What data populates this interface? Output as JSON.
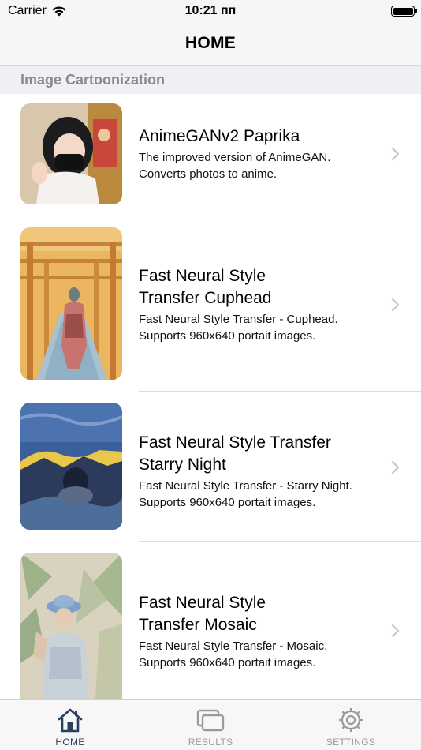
{
  "status_bar": {
    "carrier": "Carrier",
    "time": "10:21 пп"
  },
  "nav": {
    "title": "HOME"
  },
  "section": {
    "title": "Image Cartoonization"
  },
  "items": [
    {
      "title_lines": [
        "AnimeGANv2 Paprika"
      ],
      "description_lines": [
        "The improved version of AnimeGAN.",
        "Converts photos to anime."
      ]
    },
    {
      "title_lines": [
        "Fast Neural Style",
        "Transfer Cuphead"
      ],
      "description_lines": [
        "Fast Neural Style Transfer - Cuphead.",
        "Supports 960x640 portait images."
      ]
    },
    {
      "title_lines": [
        "Fast Neural Style Transfer",
        "Starry Night"
      ],
      "description_lines": [
        "Fast Neural Style Transfer - Starry Night.",
        "Supports 960x640 portait images."
      ]
    },
    {
      "title_lines": [
        "Fast Neural Style",
        "Transfer Mosaic"
      ],
      "description_lines": [
        "Fast Neural Style Transfer - Mosaic.",
        "Supports 960x640 portait images."
      ]
    }
  ],
  "tabs": [
    {
      "label": "HOME",
      "icon": "home-icon",
      "active": true
    },
    {
      "label": "RESULTS",
      "icon": "results-icon",
      "active": false
    },
    {
      "label": "SETTINGS",
      "icon": "settings-icon",
      "active": false
    }
  ],
  "colors": {
    "tab_active": "#2a3f5a",
    "tab_inactive": "#9a9a9a",
    "section_text": "#8a8a8e",
    "chevron": "#c7c7cc"
  }
}
